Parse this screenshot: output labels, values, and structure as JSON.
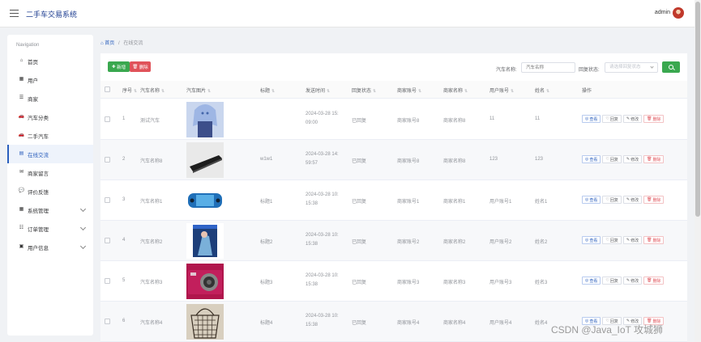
{
  "header": {
    "app_title": "二手车交易系统",
    "user": "admin"
  },
  "sidebar": {
    "nav_title": "Navigation",
    "items": [
      {
        "label": "首页",
        "icon": "home-icon"
      },
      {
        "label": "用户",
        "icon": "grid-icon"
      },
      {
        "label": "商家",
        "icon": "store-icon"
      },
      {
        "label": "汽车分类",
        "icon": "car-icon"
      },
      {
        "label": "二手汽车",
        "icon": "car-icon"
      },
      {
        "label": "在线交流",
        "icon": "chart-icon"
      },
      {
        "label": "商家留言",
        "icon": "message-icon"
      },
      {
        "label": "评价反馈",
        "icon": "comment-icon"
      },
      {
        "label": "系统管理",
        "icon": "grid-icon"
      },
      {
        "label": "订单管理",
        "icon": "list-icon"
      },
      {
        "label": "用户信息",
        "icon": "user-icon"
      }
    ],
    "active_index": 5
  },
  "breadcrumb": {
    "home": "首页",
    "separator": "/",
    "current": "在线交流"
  },
  "toolbar": {
    "add_label": "新增",
    "delete_label": "删除",
    "name_label": "汽车名称",
    "name_placeholder": "汽车名称",
    "status_label": "回复状态",
    "status_placeholder": "请选择回复状态"
  },
  "table": {
    "columns": [
      "序号",
      "汽车名称",
      "汽车图片",
      "标题",
      "发送时间",
      "回复状态",
      "商家账号",
      "商家名称",
      "用户账号",
      "姓名",
      "操作"
    ],
    "rows": [
      {
        "idx": "1",
        "car": "测试汽车",
        "title": "",
        "time1": "2024-03-28 15:",
        "time2": "09:00",
        "status": "已回复",
        "merchant_acct": "商家账号8",
        "merchant_name": "商家名称8",
        "user_acct": "11",
        "name": "11",
        "img": "anime-figure"
      },
      {
        "idx": "2",
        "car": "汽车名称8",
        "title": "w1w1",
        "time1": "2024-03-28 14:",
        "time2": "59:57",
        "status": "已回复",
        "merchant_acct": "商家账号8",
        "merchant_name": "商家名称8",
        "user_acct": "123",
        "name": "123",
        "img": "laptop"
      },
      {
        "idx": "3",
        "car": "汽车名称1",
        "title": "标题1",
        "time1": "2024-03-28 10:",
        "time2": "15:38",
        "status": "已回复",
        "merchant_acct": "商家账号1",
        "merchant_name": "商家名称1",
        "user_acct": "用户账号1",
        "name": "姓名1",
        "img": "game-console"
      },
      {
        "idx": "4",
        "car": "汽车名称2",
        "title": "标题2",
        "time1": "2024-03-28 10:",
        "time2": "15:38",
        "status": "已回复",
        "merchant_acct": "商家账号2",
        "merchant_name": "商家名称2",
        "user_acct": "用户账号2",
        "name": "姓名2",
        "img": "game-cover"
      },
      {
        "idx": "5",
        "car": "汽车名称3",
        "title": "标题3",
        "time1": "2024-03-28 10:",
        "time2": "15:38",
        "status": "已回复",
        "merchant_acct": "商家账号3",
        "merchant_name": "商家名称3",
        "user_acct": "用户账号3",
        "name": "姓名3",
        "img": "camera"
      },
      {
        "idx": "6",
        "car": "汽车名称4",
        "title": "标题4",
        "time1": "2024-03-28 10:",
        "time2": "15:38",
        "status": "已回复",
        "merchant_acct": "商家账号4",
        "merchant_name": "商家名称4",
        "user_acct": "用户账号4",
        "name": "姓名4",
        "img": "basket"
      }
    ],
    "actions": [
      "查看",
      "回复",
      "修改",
      "删除"
    ]
  },
  "watermark": "CSDN @Java_IoT 攻城狮"
}
